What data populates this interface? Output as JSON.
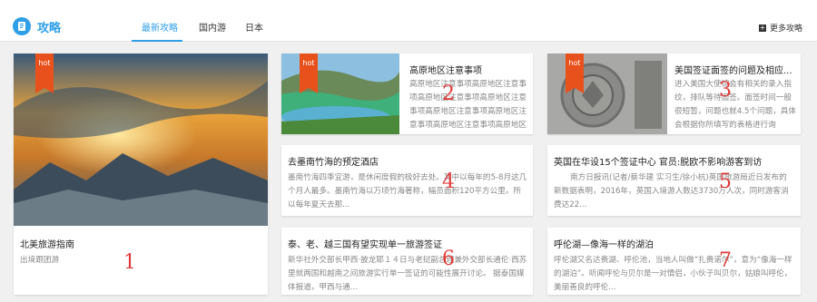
{
  "header": {
    "title": "攻略",
    "tabs": [
      {
        "label": "最新攻略"
      },
      {
        "label": "国内游"
      },
      {
        "label": "日本"
      }
    ],
    "more_label": "更多攻略"
  },
  "badge": "hot",
  "cards": [
    {
      "num": "1",
      "title": "北美旅游指南",
      "desc": "出境跟团游"
    },
    {
      "num": "2",
      "title": "高原地区注意事项",
      "desc": "高原地区注意事项高原地区注意事项高原地区注意事项高原地区注意事项高原地区注意事项高原地区注意事项高原地区注意事项高原地区注意事项"
    },
    {
      "num": "3",
      "title": "美国签证面签的问题及相应...",
      "desc": "进入美国大使馆会有相关的录入指纹，排队等待面签。面签时间一般很短暂，问题也就4.5个问题，具体会根据你所填写的表格进行询"
    },
    {
      "num": "4",
      "title": "去墨南竹海的预定酒店",
      "desc": "墨南竹海四季宜游，是休闲度假的极好去处。其中以每年的5-8月这几个月人最多。墨南竹海以万顷竹海著称，幅员面积120平方公里。所以每年夏天去那..."
    },
    {
      "num": "5",
      "title": "英国在华设15个签证中心 官员:脱欧不影响游客到访",
      "desc": "南方日报讯(记者/蔡华建 实习生/徐小杭)英国旅游局近日发布的新数据表明，2016年，英国入境游人数达3730万人次，同时游客消费达22..."
    },
    {
      "num": "6",
      "title": "泰、老、越三国有望实现单一旅游签证",
      "desc": "新华社外交部长甲西·披龙耶１４日与老挝副总理兼外交部长通伦·西苏里就两国和越南之间旅游实行单一签证的可能性展开讨论。  据泰国媒体报道，甲西与通..."
    },
    {
      "num": "7",
      "title": "呼伦湖—像海一样的湖泊",
      "desc": "呼伦湖又名达赉湖、呼伦池，当地人叫做“扎赉诺尔”，意为“像海一样的湖泊”。听闻呼伦与贝尔是一对情侣，小伙子叫贝尔，姑娘叫呼伦，美丽善良的呼伦..."
    }
  ]
}
